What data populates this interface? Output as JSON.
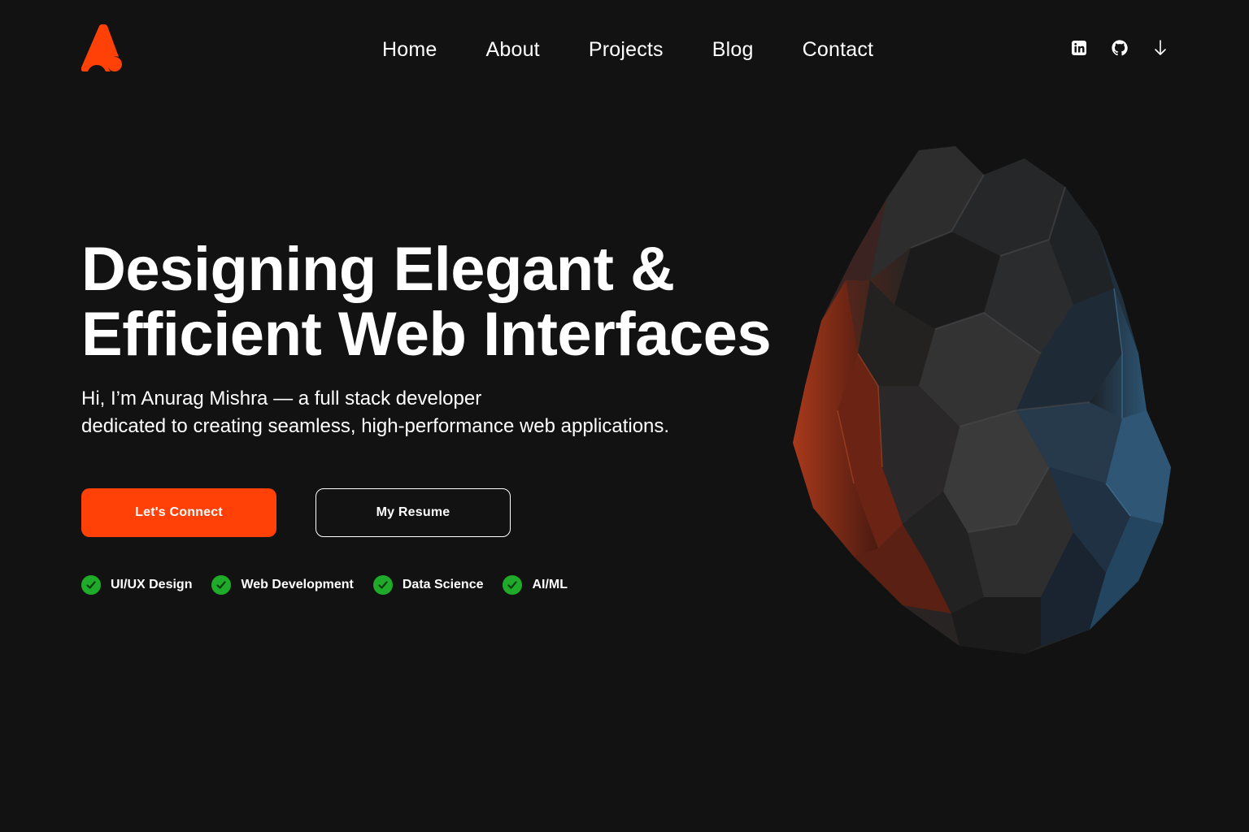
{
  "colors": {
    "background": "#121212",
    "accent": "#ff4108",
    "text": "#ffffff",
    "check": "#1faa2a"
  },
  "header": {
    "logo_icon": "brand-logo",
    "nav": [
      "Home",
      "About",
      "Projects",
      "Blog",
      "Contact"
    ],
    "social_icons": [
      "linkedin-icon",
      "github-icon",
      "arrow-down-icon"
    ]
  },
  "hero": {
    "title_line1": "Designing Elegant &",
    "title_line2": "Efficient Web Interfaces",
    "subtitle_line1": "Hi, I’m Anurag Mishra — a full stack developer",
    "subtitle_line2": "dedicated to creating seamless, high-performance web applications.",
    "primary_button": "Let's Connect",
    "secondary_button": "My Resume",
    "skills": [
      "UI/UX Design",
      "Web Development",
      "Data Science",
      "AI/ML"
    ]
  },
  "illustration": "faceted-rock-image"
}
